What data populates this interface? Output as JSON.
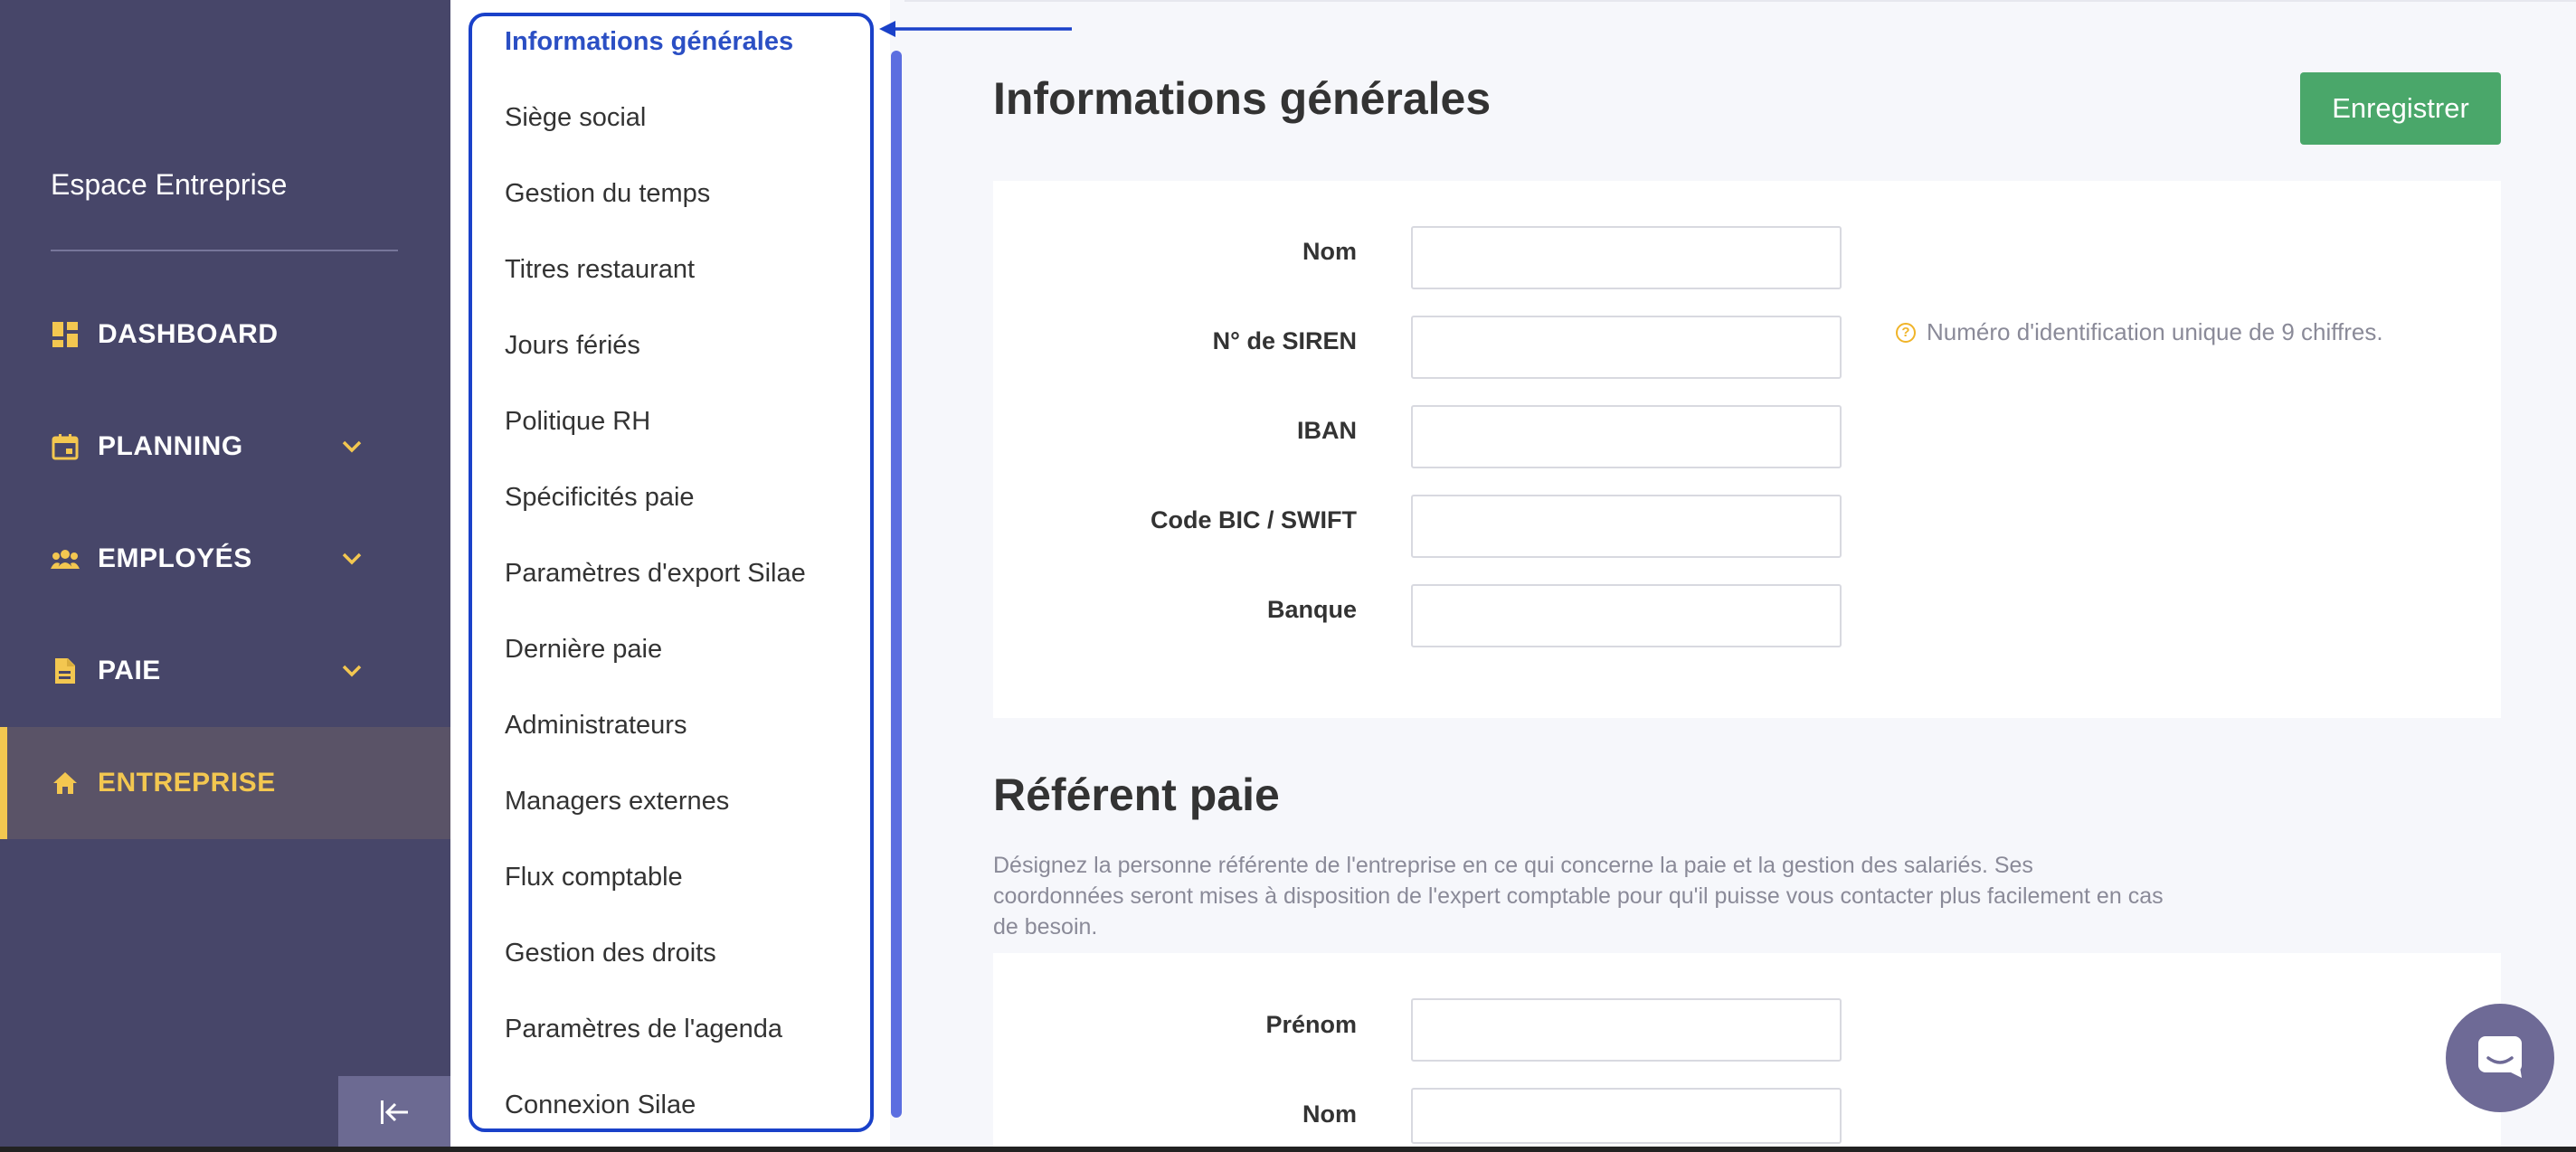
{
  "nav": {
    "title": "Espace Entreprise",
    "items": [
      {
        "label": "DASHBOARD",
        "icon": "dashboard-icon",
        "has_chevron": false,
        "active": false
      },
      {
        "label": "PLANNING",
        "icon": "calendar-icon",
        "has_chevron": true,
        "active": false
      },
      {
        "label": "EMPLOYÉS",
        "icon": "people-icon",
        "has_chevron": true,
        "active": false
      },
      {
        "label": "PAIE",
        "icon": "document-icon",
        "has_chevron": true,
        "active": false
      },
      {
        "label": "ENTREPRISE",
        "icon": "home-icon",
        "has_chevron": false,
        "active": true
      }
    ]
  },
  "submenu": {
    "items": [
      "Informations générales",
      "Siège social",
      "Gestion du temps",
      "Titres restaurant",
      "Jours fériés",
      "Politique RH",
      "Spécificités paie",
      "Paramètres d'export Silae",
      "Dernière paie",
      "Administrateurs",
      "Managers externes",
      "Flux comptable",
      "Gestion des droits",
      "Paramètres de l'agenda",
      "Connexion Silae"
    ],
    "active_index": 0
  },
  "main": {
    "title": "Informations générales",
    "save_label": "Enregistrer",
    "general_fields": [
      {
        "label": "Nom",
        "value": ""
      },
      {
        "label": "N° de SIREN",
        "value": ""
      },
      {
        "label": "IBAN",
        "value": ""
      },
      {
        "label": "Code BIC / SWIFT",
        "value": ""
      },
      {
        "label": "Banque",
        "value": ""
      }
    ],
    "siren_hint": "Numéro d'identification unique de 9 chiffres.",
    "referent_title": "Référent paie",
    "referent_description": "Désignez la personne référente de l'entreprise en ce qui concerne la paie et la gestion des salariés. Ses coordonnées seront mises à disposition de l'expert comptable pour qu'il puisse vous contacter plus facilement en cas de besoin.",
    "referent_fields": [
      {
        "label": "Prénom",
        "value": ""
      },
      {
        "label": "Nom",
        "value": ""
      }
    ]
  },
  "colors": {
    "sidebar_bg": "#474669",
    "accent_yellow": "#f3c750",
    "active_blue": "#2b4fc4",
    "highlight_blue": "#1a41c9",
    "save_green": "#4aa76a"
  }
}
